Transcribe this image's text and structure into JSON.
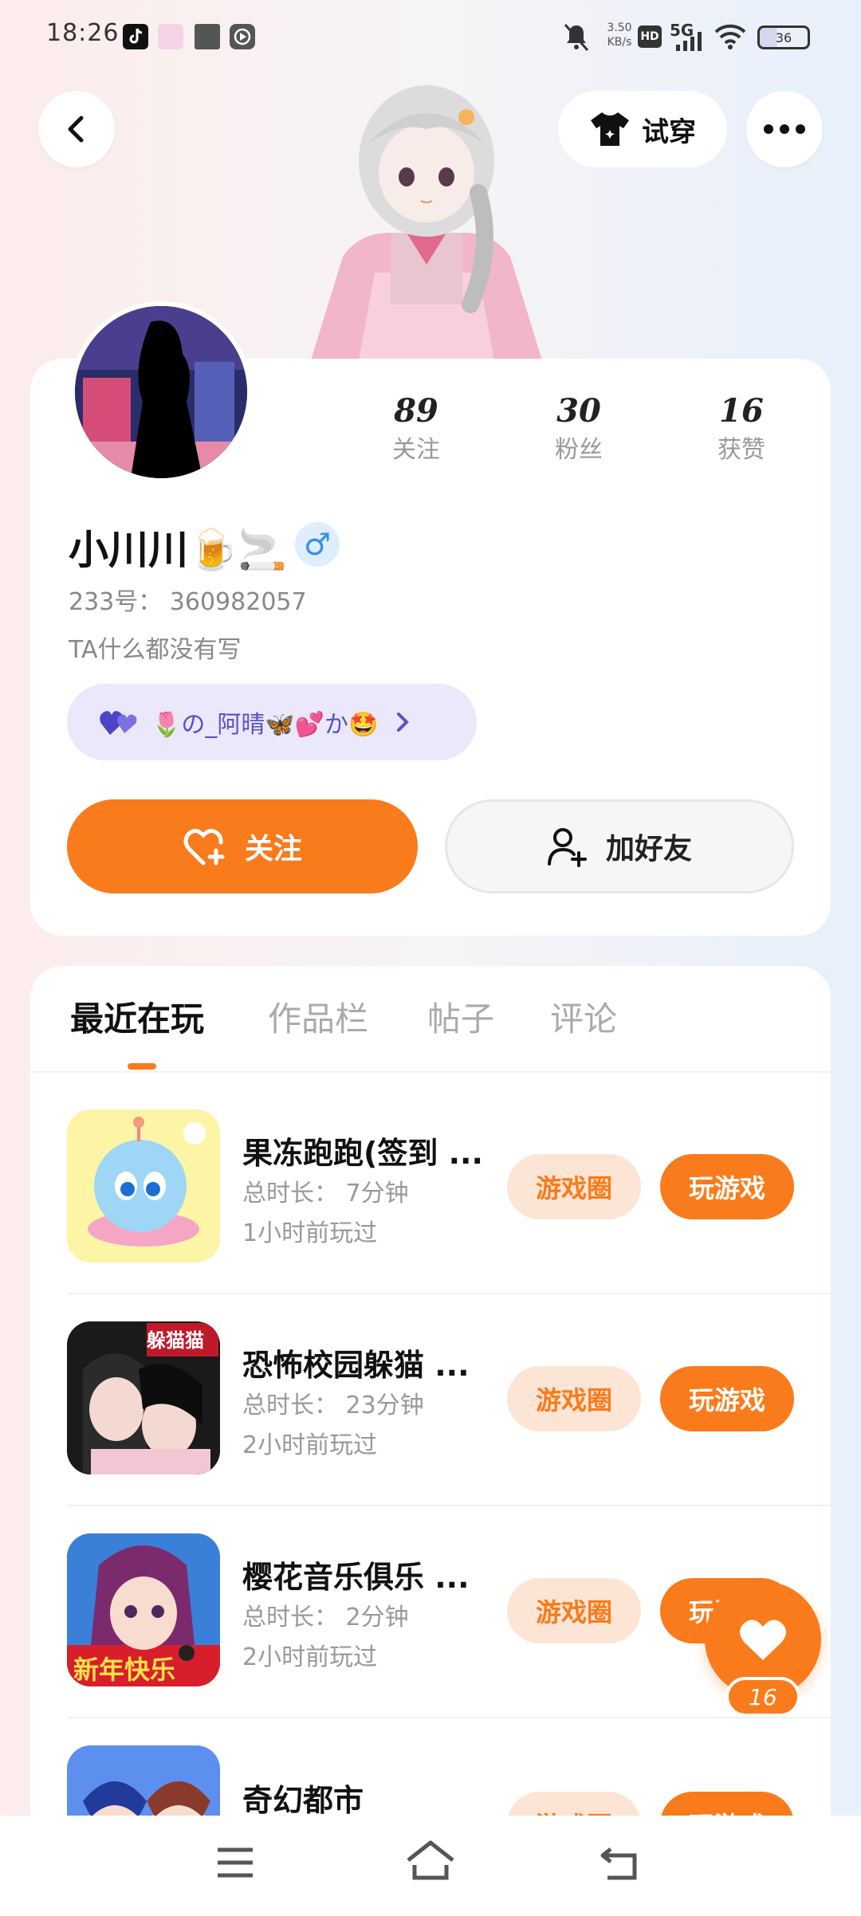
{
  "status_bar": {
    "time": "18:26",
    "net_speed_top": "3.50",
    "net_speed_bottom": "KB/s",
    "hd": "HD",
    "signal": "5G",
    "battery": "36"
  },
  "header": {
    "try_on_label": "试穿"
  },
  "profile": {
    "stats": [
      {
        "value": "89",
        "label": "关注"
      },
      {
        "value": "30",
        "label": "粉丝"
      },
      {
        "value": "16",
        "label": "获赞"
      }
    ],
    "username": "小川川🍺🚬",
    "gender_symbol": "♂",
    "uid": "233号： 360982057",
    "bio": "TA什么都没有写",
    "guard_text": "🌷の_阿晴🦋💕か🤩",
    "follow_label": "关注",
    "add_friend_label": "加好友"
  },
  "tabs": [
    {
      "label": "最近在玩",
      "active": true
    },
    {
      "label": "作品栏",
      "active": false
    },
    {
      "label": "帖子",
      "active": false
    },
    {
      "label": "评论",
      "active": false
    }
  ],
  "games": [
    {
      "title": "果冻跑跑(签到 ...",
      "duration": "总时长： 7分钟",
      "last_played": "1小时前玩过",
      "circle_label": "游戏圈",
      "play_label": "玩游戏"
    },
    {
      "title": "恐怖校园躲猫 ...",
      "duration": "总时长： 23分钟",
      "last_played": "2小时前玩过",
      "circle_label": "游戏圈",
      "play_label": "玩游戏",
      "badge": "躲猫猫"
    },
    {
      "title": "樱花音乐俱乐 ...",
      "duration": "总时长： 2分钟",
      "last_played": "2小时前玩过",
      "circle_label": "游戏圈",
      "play_label": "玩游戏",
      "badge": "新年快乐"
    },
    {
      "title": "奇幻都市",
      "duration": "",
      "last_played": "",
      "circle_label": "游戏圈",
      "play_label": "玩游戏"
    }
  ],
  "like_fab": {
    "count": "16"
  },
  "colors": {
    "accent": "#f97b1c",
    "accent_light": "#fde5d6",
    "guard_bg": "#ebe8fb"
  }
}
